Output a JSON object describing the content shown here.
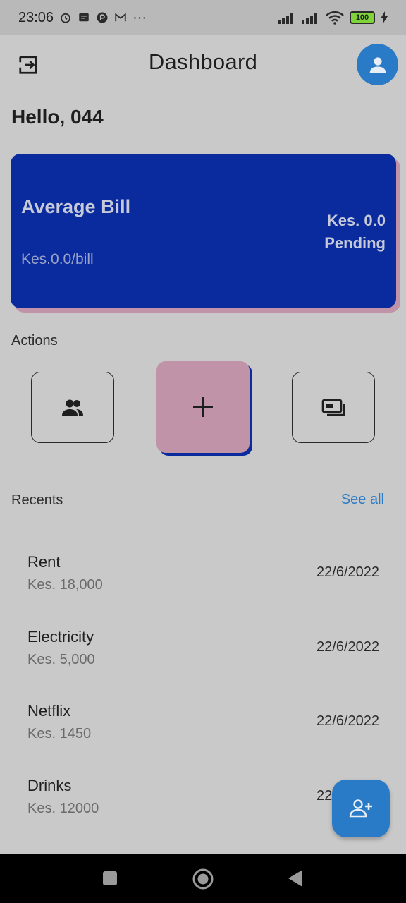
{
  "status_bar": {
    "time": "23:06",
    "more": "···",
    "battery": "100"
  },
  "app_bar": {
    "title": "Dashboard"
  },
  "greeting": "Hello, 044",
  "summary_card": {
    "title": "Average Bill",
    "subtitle": "Kes.0.0/bill",
    "amount": "Kes. 0.0",
    "status": "Pending"
  },
  "actions": {
    "label": "Actions",
    "buttons": [
      {
        "icon": "group-icon"
      },
      {
        "icon": "add-icon"
      },
      {
        "icon": "payments-icon"
      }
    ]
  },
  "recents": {
    "label": "Recents",
    "see_all": "See all",
    "items": [
      {
        "name": "Rent",
        "amount": "Kes. 18,000",
        "date": "22/6/2022"
      },
      {
        "name": "Electricity",
        "amount": "Kes. 5,000",
        "date": "22/6/2022"
      },
      {
        "name": "Netflix",
        "amount": "Kes. 1450",
        "date": "22/6/2022"
      },
      {
        "name": "Drinks",
        "amount": "Kes. 12000",
        "date": "22/6/2022"
      }
    ]
  },
  "fab": {
    "icon": "person-add-icon"
  },
  "colors": {
    "background": "#c9c9c9",
    "card": "#0a2b9e",
    "accent_pink": "#c093a8",
    "accent_blue": "#2a7bc7"
  }
}
